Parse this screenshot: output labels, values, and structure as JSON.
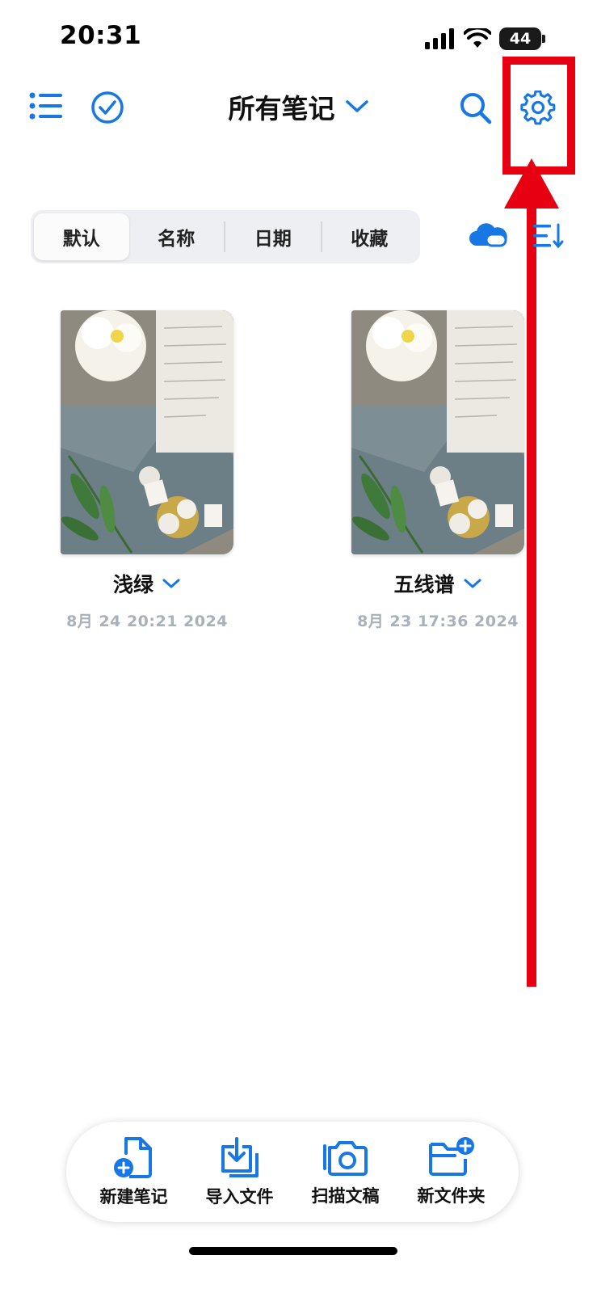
{
  "status_bar": {
    "time": "20:31",
    "battery": "44"
  },
  "nav": {
    "title": "所有笔记",
    "icons": [
      "list-icon",
      "checkmark-circle-icon",
      "chevron-down-icon",
      "search-icon",
      "gear-icon"
    ]
  },
  "sort_tabs": [
    {
      "label": "默认",
      "active": true
    },
    {
      "label": "名称",
      "active": false
    },
    {
      "label": "日期",
      "active": false
    },
    {
      "label": "收藏",
      "active": false
    }
  ],
  "notes": [
    {
      "title": "浅绿",
      "date": "8月 24 20:21 2024"
    },
    {
      "title": "五线谱",
      "date": "8月 23 17:36 2024"
    }
  ],
  "toolbar": {
    "new_note": "新建笔记",
    "import_file": "导入文件",
    "scan_document": "扫描文稿",
    "new_folder": "新文件夹"
  },
  "colors": {
    "accent": "#1677e5",
    "annotation": "#e60012",
    "date_text": "#a8b1bb"
  }
}
